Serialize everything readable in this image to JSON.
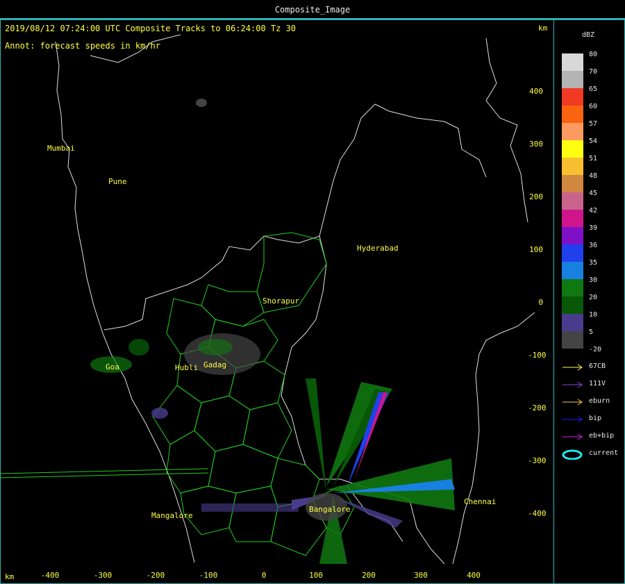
{
  "window": {
    "title": "Composite_Image"
  },
  "header": {
    "line1": "2019/08/12 07:24:00 UTC Composite Tracks to 06:24:00 Tz 30",
    "line2": "Annot: forecast speeds in km/hr",
    "unit_top": "km",
    "unit_bottom": "km"
  },
  "cities": [
    {
      "name": "Mumbai"
    },
    {
      "name": "Pune"
    },
    {
      "name": "Hyderabad"
    },
    {
      "name": "Shorapur"
    },
    {
      "name": "Goa"
    },
    {
      "name": "Hubli"
    },
    {
      "name": "Gadag"
    },
    {
      "name": "Mangalore"
    },
    {
      "name": "Bangalore"
    },
    {
      "name": "Chennai"
    }
  ],
  "y_ticks": [
    "400",
    "300",
    "200",
    "100",
    "0",
    "-100",
    "-200",
    "-300",
    "-400"
  ],
  "x_ticks": [
    "-400",
    "-300",
    "-200",
    "-100",
    "0",
    "100",
    "200",
    "300",
    "400"
  ],
  "legend": {
    "title": "dBZ",
    "scale": [
      {
        "label": "80",
        "color": "#d8d8d8"
      },
      {
        "label": "70",
        "color": "#b4b4b4"
      },
      {
        "label": "65",
        "color": "#f03a24"
      },
      {
        "label": "60",
        "color": "#f86410"
      },
      {
        "label": "57",
        "color": "#fc9a62"
      },
      {
        "label": "54",
        "color": "#ffff10"
      },
      {
        "label": "51",
        "color": "#f8c030"
      },
      {
        "label": "48",
        "color": "#d08840"
      },
      {
        "label": "45",
        "color": "#c8648c"
      },
      {
        "label": "42",
        "color": "#d0148c"
      },
      {
        "label": "39",
        "color": "#8010c8"
      },
      {
        "label": "36",
        "color": "#2040ec"
      },
      {
        "label": "35",
        "color": "#1880e0"
      },
      {
        "label": "30",
        "color": "#107810"
      },
      {
        "label": "20",
        "color": "#085808"
      },
      {
        "label": "10",
        "color": "#4a3c8c"
      },
      {
        "label": "5",
        "color": "#444444"
      },
      {
        "label": "-20",
        "color": "#000000"
      }
    ],
    "tracks": [
      {
        "label": "67CB",
        "color": "#ffff40"
      },
      {
        "label": "111V",
        "color": "#9040e0"
      },
      {
        "label": "eburn",
        "color": "#ffd040"
      },
      {
        "label": "bip",
        "color": "#2020ff"
      },
      {
        "label": "eb+bip",
        "color": "#e020e0"
      },
      {
        "label": "current",
        "color": "#20e8f0"
      }
    ]
  }
}
